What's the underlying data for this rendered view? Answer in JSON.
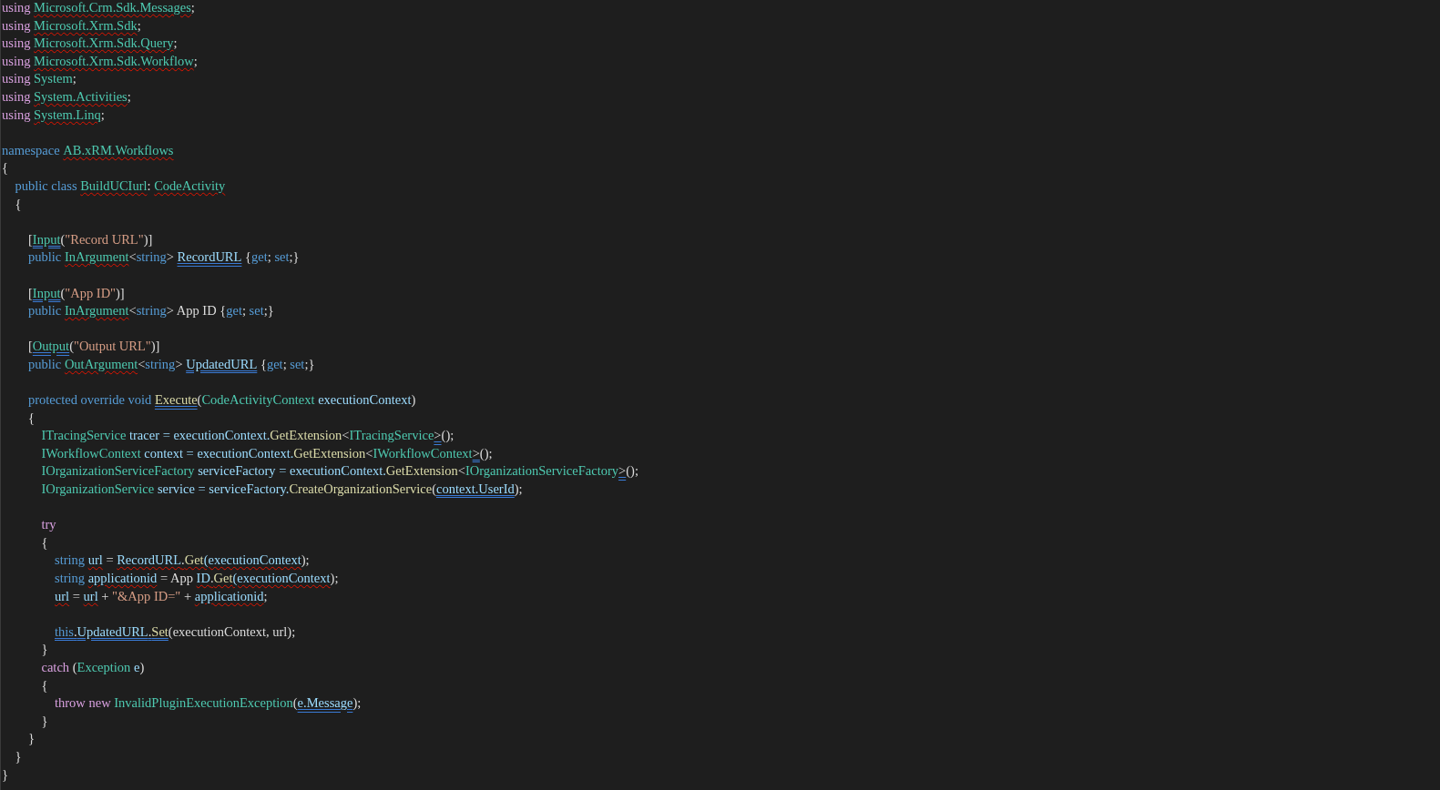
{
  "editor": {
    "blocks": [
      {
        "lines": [
          {
            "tokens": [
              {
                "text": "using ",
                "kind": "ctrl"
              },
              {
                "text": "Microsoft.Crm.Sdk.Messages",
                "kind": "type",
                "error": true
              },
              {
                "text": ";",
                "kind": "plain"
              }
            ]
          },
          {
            "tokens": [
              {
                "text": "using ",
                "kind": "ctrl"
              },
              {
                "text": "Microsoft.Xrm.Sdk",
                "kind": "type",
                "error": true
              },
              {
                "text": ";",
                "kind": "plain"
              }
            ]
          },
          {
            "tokens": [
              {
                "text": "using ",
                "kind": "ctrl"
              },
              {
                "text": "Microsoft.Xrm.Sdk.Query",
                "kind": "type",
                "error": true
              },
              {
                "text": ";",
                "kind": "plain"
              }
            ]
          },
          {
            "tokens": [
              {
                "text": "using ",
                "kind": "ctrl"
              },
              {
                "text": "Microsoft.Xrm.Sdk.Workflow",
                "kind": "type",
                "error": true
              },
              {
                "text": ";",
                "kind": "plain"
              }
            ]
          },
          {
            "tokens": [
              {
                "text": "using ",
                "kind": "ctrl"
              },
              {
                "text": "System",
                "kind": "type",
                "error": false
              },
              {
                "text": ";",
                "kind": "plain"
              }
            ]
          },
          {
            "tokens": [
              {
                "text": "using ",
                "kind": "ctrl"
              },
              {
                "text": "System.Activities",
                "kind": "type",
                "error": true
              },
              {
                "text": ";",
                "kind": "plain"
              }
            ]
          },
          {
            "tokens": [
              {
                "text": "using ",
                "kind": "ctrl"
              },
              {
                "text": "System.Linq",
                "kind": "type",
                "error": true
              },
              {
                "text": ";",
                "kind": "plain"
              }
            ]
          }
        ]
      },
      {
        "lines": [
          {
            "tokens": [
              {
                "text": "namespace ",
                "kind": "kw"
              },
              {
                "text": "AB.xRM.Workflows",
                "kind": "type",
                "error": true
              }
            ]
          },
          {
            "tokens": [
              {
                "text": "{",
                "kind": "plain"
              }
            ]
          },
          {
            "tokens": [
              {
                "text": "    public class ",
                "kind": "kw"
              },
              {
                "text": "BuildUCIurl",
                "kind": "type",
                "error": true
              },
              {
                "text": ": ",
                "kind": "plain"
              },
              {
                "text": "CodeActivity",
                "kind": "type",
                "error": true
              }
            ]
          },
          {
            "tokens": [
              {
                "text": "    {",
                "kind": "plain"
              }
            ]
          }
        ]
      },
      {
        "lines": [
          {
            "tokens": [
              {
                "text": "        [",
                "kind": "plain"
              },
              {
                "text": "Input",
                "kind": "type",
                "hint": true
              },
              {
                "text": "(",
                "kind": "plain"
              },
              {
                "text": "\"Record URL\"",
                "kind": "str"
              },
              {
                "text": ")]",
                "kind": "plain"
              }
            ]
          },
          {
            "tokens": [
              {
                "text": "        public ",
                "kind": "kw"
              },
              {
                "text": "InArgument",
                "kind": "type",
                "error": true
              },
              {
                "text": "<",
                "kind": "plain"
              },
              {
                "text": "string",
                "kind": "kw"
              },
              {
                "text": "> ",
                "kind": "plain"
              },
              {
                "text": "RecordURL",
                "kind": "var",
                "hint": true
              },
              {
                "text": " {",
                "kind": "plain"
              },
              {
                "text": "get",
                "kind": "kw"
              },
              {
                "text": "; ",
                "kind": "plain"
              },
              {
                "text": "set",
                "kind": "kw"
              },
              {
                "text": ";}",
                "kind": "plain"
              }
            ]
          }
        ]
      },
      {
        "lines": [
          {
            "tokens": [
              {
                "text": "        [",
                "kind": "plain"
              },
              {
                "text": "Input",
                "kind": "type",
                "hint": true
              },
              {
                "text": "(",
                "kind": "plain"
              },
              {
                "text": "\"App ID\"",
                "kind": "str"
              },
              {
                "text": ")]",
                "kind": "plain"
              }
            ]
          },
          {
            "tokens": [
              {
                "text": "        public ",
                "kind": "kw"
              },
              {
                "text": "InArgument",
                "kind": "type",
                "error": true
              },
              {
                "text": "<",
                "kind": "plain"
              },
              {
                "text": "string",
                "kind": "kw"
              },
              {
                "text": "> App ID {",
                "kind": "plain"
              },
              {
                "text": "get",
                "kind": "kw"
              },
              {
                "text": "; ",
                "kind": "plain"
              },
              {
                "text": "set",
                "kind": "kw"
              },
              {
                "text": ";}",
                "kind": "plain"
              }
            ]
          }
        ]
      },
      {
        "lines": [
          {
            "tokens": [
              {
                "text": "        [",
                "kind": "plain"
              },
              {
                "text": "Output",
                "kind": "type",
                "hint": true
              },
              {
                "text": "(",
                "kind": "plain"
              },
              {
                "text": "\"Output URL\"",
                "kind": "str"
              },
              {
                "text": ")]",
                "kind": "plain"
              }
            ]
          },
          {
            "tokens": [
              {
                "text": "        public ",
                "kind": "kw"
              },
              {
                "text": "OutArgument",
                "kind": "type",
                "error": true
              },
              {
                "text": "<",
                "kind": "plain"
              },
              {
                "text": "string",
                "kind": "kw"
              },
              {
                "text": "> ",
                "kind": "plain"
              },
              {
                "text": "UpdatedURL",
                "kind": "var",
                "hint": true
              },
              {
                "text": " {",
                "kind": "plain"
              },
              {
                "text": "get",
                "kind": "kw"
              },
              {
                "text": "; ",
                "kind": "plain"
              },
              {
                "text": "set",
                "kind": "kw"
              },
              {
                "text": ";}",
                "kind": "plain"
              }
            ]
          }
        ]
      },
      {
        "lines": [
          {
            "tokens": [
              {
                "text": "        protected override void ",
                "kind": "kw"
              },
              {
                "text": "Execute",
                "kind": "fn",
                "hint": true
              },
              {
                "text": "(",
                "kind": "plain"
              },
              {
                "text": "CodeActivityContext",
                "kind": "type"
              },
              {
                "text": " executionContext",
                "kind": "var"
              },
              {
                "text": ")",
                "kind": "plain"
              }
            ]
          },
          {
            "tokens": [
              {
                "text": "        {",
                "kind": "plain"
              }
            ]
          },
          {
            "tokens": [
              {
                "text": "            ITracingService",
                "kind": "type"
              },
              {
                "text": " tracer = executionContext.",
                "kind": "var"
              },
              {
                "text": "GetExtension",
                "kind": "fn"
              },
              {
                "text": "<",
                "kind": "plain"
              },
              {
                "text": "ITracingService",
                "kind": "type"
              },
              {
                "text": ">",
                "kind": "plain",
                "hint": true
              },
              {
                "text": "();",
                "kind": "plain"
              }
            ]
          },
          {
            "tokens": [
              {
                "text": "            IWorkflowContext",
                "kind": "type"
              },
              {
                "text": " context = executionContext.",
                "kind": "var"
              },
              {
                "text": "GetExtension",
                "kind": "fn"
              },
              {
                "text": "<",
                "kind": "plain"
              },
              {
                "text": "IWorkflowContext",
                "kind": "type"
              },
              {
                "text": ">",
                "kind": "plain",
                "hint": true
              },
              {
                "text": "();",
                "kind": "plain"
              }
            ]
          },
          {
            "tokens": [
              {
                "text": "            IOrganizationServiceFactory",
                "kind": "type"
              },
              {
                "text": " serviceFactory = executionContext.",
                "kind": "var"
              },
              {
                "text": "GetExtension",
                "kind": "fn"
              },
              {
                "text": "<",
                "kind": "plain"
              },
              {
                "text": "IOrganizationServiceFactory",
                "kind": "type"
              },
              {
                "text": ">",
                "kind": "plain",
                "hint": true
              },
              {
                "text": "();",
                "kind": "plain"
              }
            ]
          },
          {
            "tokens": [
              {
                "text": "            IOrganizationService",
                "kind": "type"
              },
              {
                "text": " service = serviceFactory.",
                "kind": "var"
              },
              {
                "text": "CreateOrganizationService",
                "kind": "fn"
              },
              {
                "text": "(",
                "kind": "plain"
              },
              {
                "text": "context.UserId",
                "kind": "var",
                "hint": true
              },
              {
                "text": ");",
                "kind": "plain"
              }
            ]
          }
        ]
      },
      {
        "lines": [
          {
            "tokens": [
              {
                "text": "            try",
                "kind": "ctrl"
              }
            ]
          },
          {
            "tokens": [
              {
                "text": "            {",
                "kind": "plain"
              }
            ]
          },
          {
            "tokens": [
              {
                "text": "                string ",
                "kind": "kw"
              },
              {
                "text": "url",
                "kind": "var",
                "error": true
              },
              {
                "text": " = ",
                "kind": "plain"
              },
              {
                "text": "RecordURL",
                "kind": "var",
                "error": true
              },
              {
                "text": ".",
                "kind": "plain",
                "error": true
              },
              {
                "text": "Get",
                "kind": "fn",
                "error": true
              },
              {
                "text": "(executionContext",
                "kind": "var",
                "error": true
              },
              {
                "text": ");",
                "kind": "plain"
              }
            ]
          },
          {
            "tokens": [
              {
                "text": "                string ",
                "kind": "kw"
              },
              {
                "text": "applicationid",
                "kind": "var",
                "error": true
              },
              {
                "text": " = App ",
                "kind": "plain"
              },
              {
                "text": "ID",
                "kind": "var",
                "error": true
              },
              {
                "text": ".",
                "kind": "plain",
                "error": true
              },
              {
                "text": "Get",
                "kind": "fn",
                "error": true
              },
              {
                "text": "(executionContext",
                "kind": "var",
                "error": true
              },
              {
                "text": ");",
                "kind": "plain"
              }
            ]
          },
          {
            "tokens": [
              {
                "text": "                url",
                "kind": "var",
                "error": true
              },
              {
                "text": " = ",
                "kind": "plain"
              },
              {
                "text": "url",
                "kind": "var",
                "error": true
              },
              {
                "text": " + ",
                "kind": "plain"
              },
              {
                "text": "\"&App ID=\"",
                "kind": "str"
              },
              {
                "text": " + ",
                "kind": "plain"
              },
              {
                "text": "applicationid",
                "kind": "var",
                "error": true
              },
              {
                "text": ";",
                "kind": "plain"
              }
            ]
          }
        ]
      },
      {
        "lines": [
          {
            "tokens": [
              {
                "text": "                this",
                "kind": "kw",
                "hint": true
              },
              {
                "text": ".",
                "kind": "plain",
                "hint": true
              },
              {
                "text": "UpdatedURL",
                "kind": "var",
                "hint": true
              },
              {
                "text": ".",
                "kind": "plain",
                "hint": true
              },
              {
                "text": "Set",
                "kind": "fn",
                "hint": true
              },
              {
                "text": "(executionContext, url);",
                "kind": "plain"
              }
            ]
          },
          {
            "tokens": [
              {
                "text": "            }",
                "kind": "plain"
              }
            ]
          },
          {
            "tokens": [
              {
                "text": "            catch ",
                "kind": "ctrl"
              },
              {
                "text": "(",
                "kind": "plain"
              },
              {
                "text": "Exception",
                "kind": "type"
              },
              {
                "text": " e",
                "kind": "var"
              },
              {
                "text": ")",
                "kind": "plain"
              }
            ]
          },
          {
            "tokens": [
              {
                "text": "            {",
                "kind": "plain"
              }
            ]
          },
          {
            "tokens": [
              {
                "text": "                throw new ",
                "kind": "ctrl"
              },
              {
                "text": "InvalidPluginExecutionException",
                "kind": "type"
              },
              {
                "text": "(",
                "kind": "plain"
              },
              {
                "text": "e.Message",
                "kind": "var",
                "hint": true
              },
              {
                "text": ");",
                "kind": "plain"
              }
            ]
          },
          {
            "tokens": [
              {
                "text": "            }",
                "kind": "plain"
              }
            ]
          },
          {
            "tokens": [
              {
                "text": "        }",
                "kind": "plain"
              }
            ]
          },
          {
            "tokens": [
              {
                "text": "    }",
                "kind": "plain"
              }
            ]
          },
          {
            "tokens": [
              {
                "text": "}",
                "kind": "plain"
              }
            ]
          }
        ]
      }
    ]
  }
}
